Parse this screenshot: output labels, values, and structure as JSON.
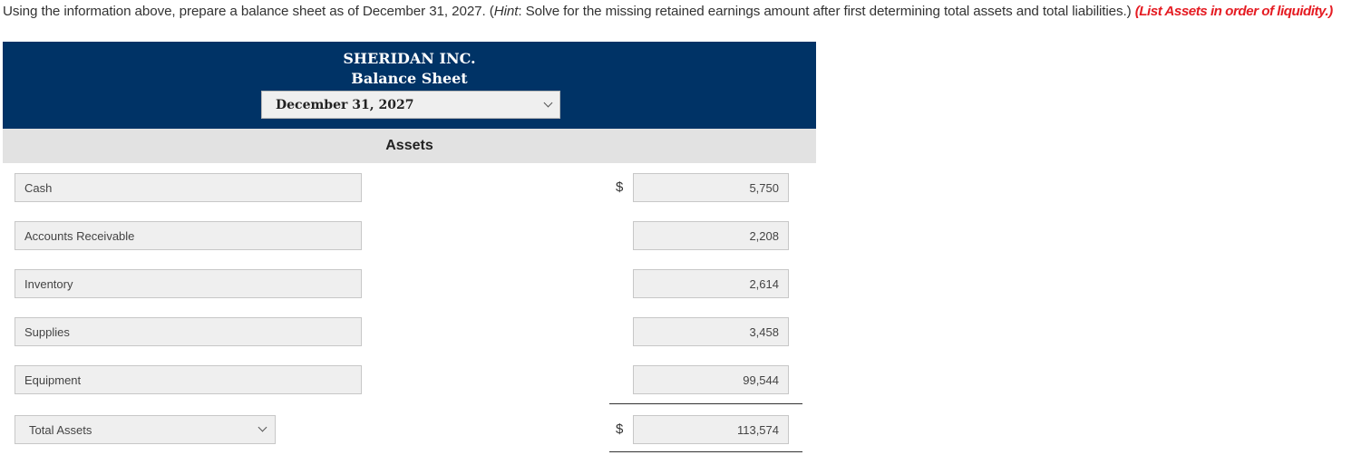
{
  "instructions": {
    "lead": "Using the information above, prepare a balance sheet as of December 31, 2027. (",
    "hint_label": "Hint",
    "hint_text": ": Solve for the missing retained earnings amount after first determining total assets and total liabilities.) ",
    "note": "(List Assets in order of liquidity.)"
  },
  "header": {
    "company": "SHERIDAN INC.",
    "statement": "Balance Sheet",
    "date_selected": "December 31, 2027"
  },
  "section": {
    "title": "Assets"
  },
  "currency_symbol": "$",
  "rows": [
    {
      "account": "Cash",
      "amount": "5,750"
    },
    {
      "account": "Accounts Receivable",
      "amount": "2,208"
    },
    {
      "account": "Inventory",
      "amount": "2,614"
    },
    {
      "account": "Supplies",
      "amount": "3,458"
    },
    {
      "account": "Equipment",
      "amount": "99,544"
    }
  ],
  "total": {
    "label": "Total Assets",
    "amount": "113,574"
  },
  "colors": {
    "header_bg": "#003366",
    "section_bg": "#e2e2e2",
    "note_red": "#e51c23"
  }
}
